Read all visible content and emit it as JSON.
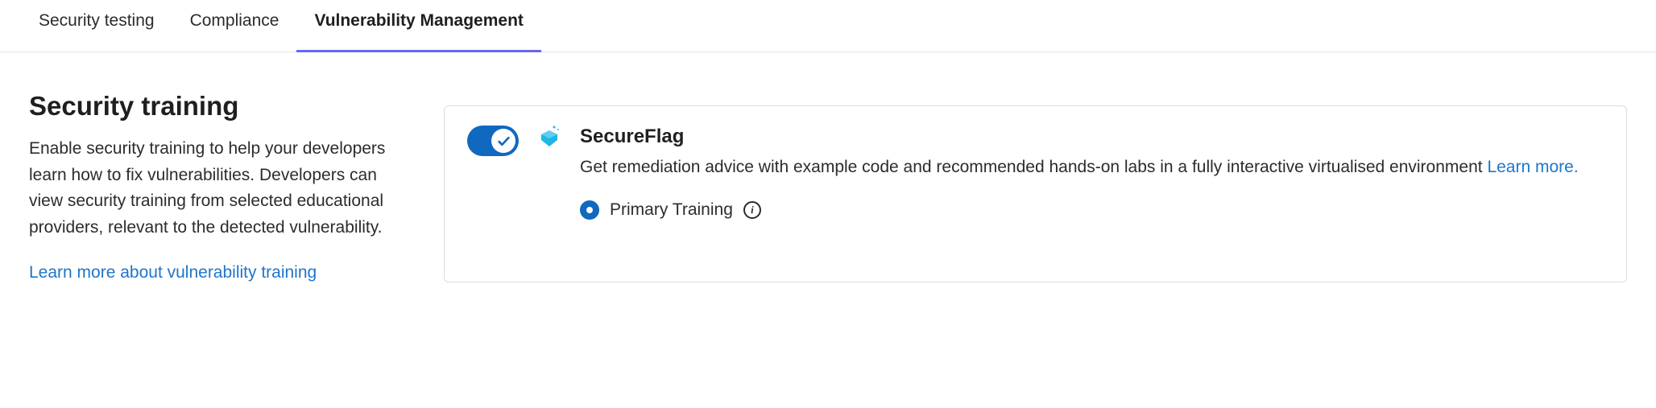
{
  "tabs": [
    {
      "label": "Security testing",
      "active": false
    },
    {
      "label": "Compliance",
      "active": false
    },
    {
      "label": "Vulnerability Management",
      "active": true
    }
  ],
  "section": {
    "title": "Security training",
    "description": "Enable security training to help your developers learn how to fix vulnerabilities. Developers can view security training from selected educational providers, relevant to the detected vulnerability.",
    "learn_more_label": "Learn more about vulnerability training"
  },
  "provider": {
    "enabled": true,
    "name": "SecureFlag",
    "description": "Get remediation advice with example code and recommended hands-on labs in a fully interactive virtualised environment ",
    "learn_more_label": "Learn more.",
    "primary": {
      "label": "Primary Training",
      "selected": true
    }
  }
}
